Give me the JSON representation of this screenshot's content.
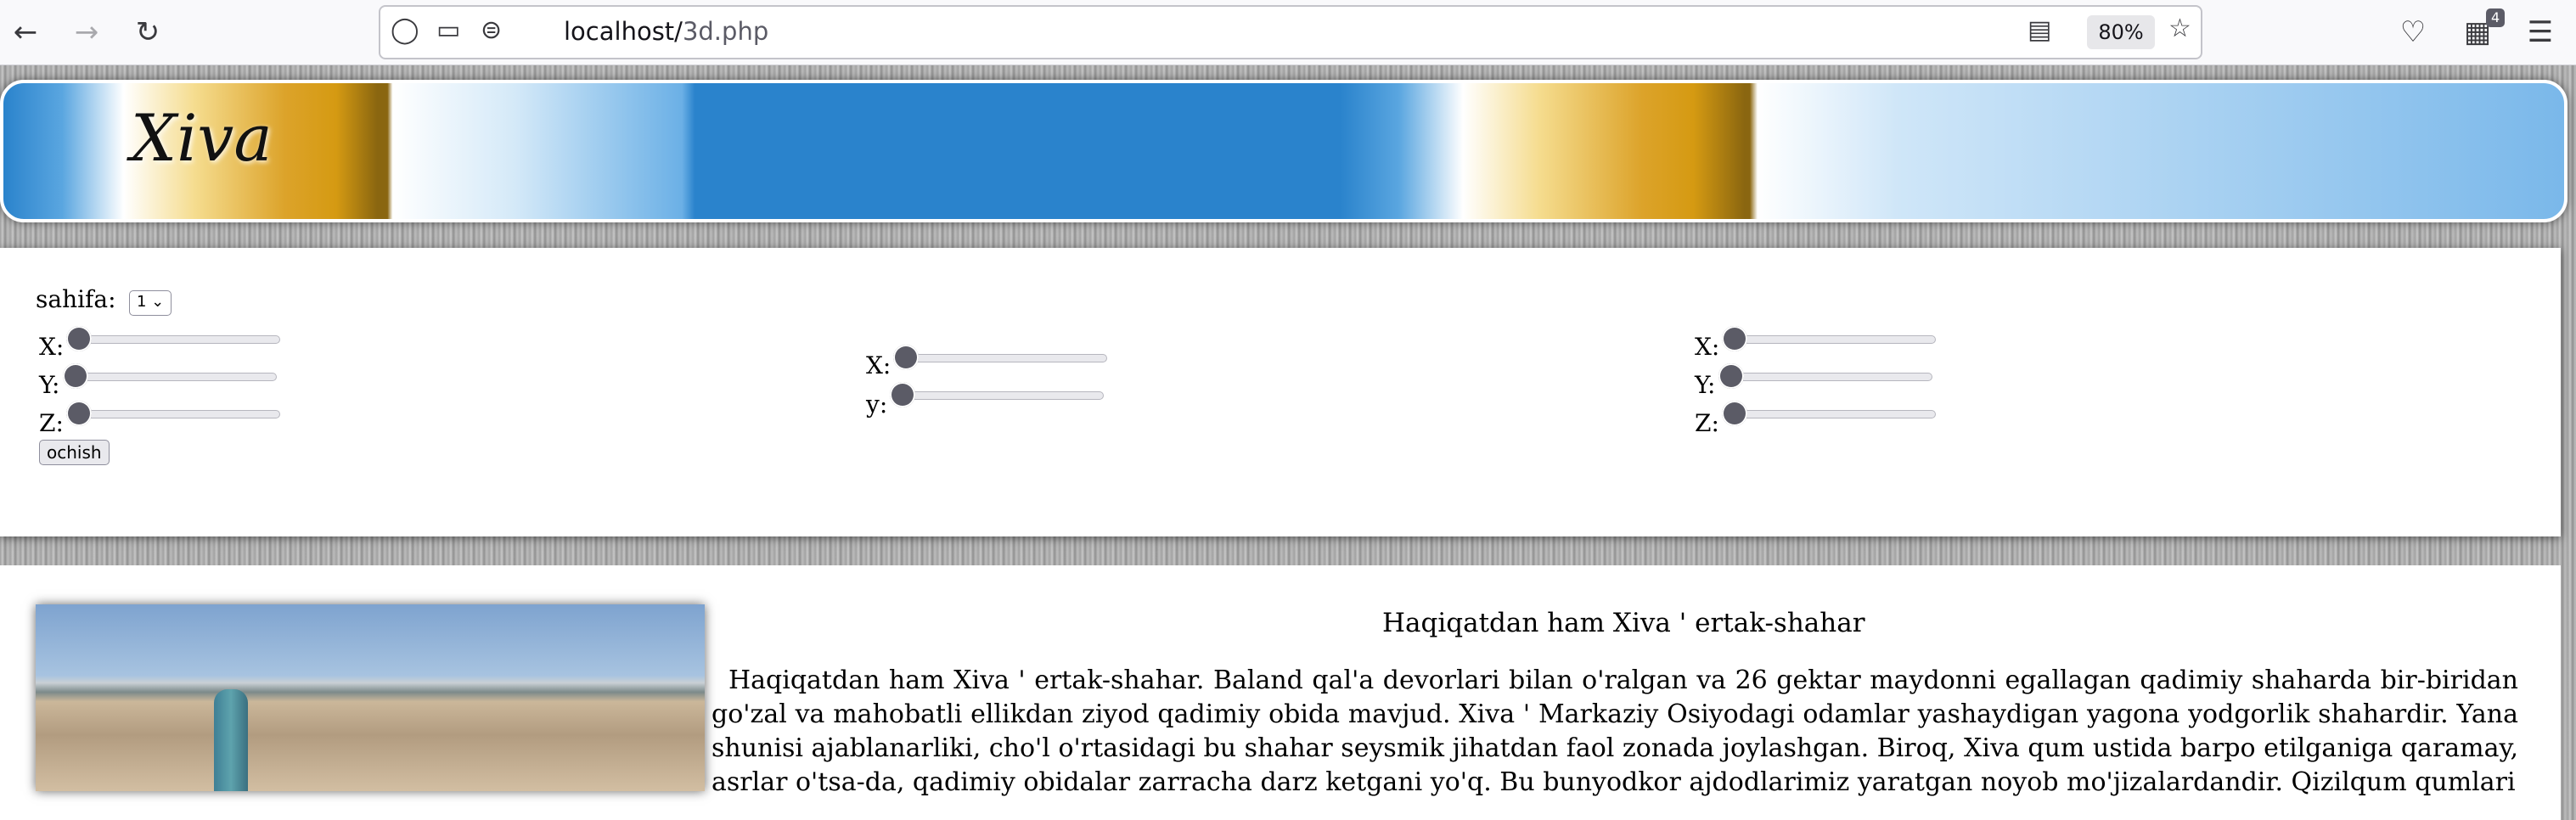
{
  "browser": {
    "url_host": "localhost/",
    "url_path": "3d.php",
    "zoom": "80%",
    "extensions_badge": "4"
  },
  "banner": {
    "title": "Xiva"
  },
  "controls": {
    "page_label": "sahifa:",
    "page_select_value": "1",
    "group1": {
      "x_label": "X:",
      "y_label": "Y:",
      "z_label": "Z:",
      "x_value": 0,
      "y_value": 0,
      "z_value": 0
    },
    "open_button": "ochish",
    "group2": {
      "x_label": "X:",
      "y_label": "y:",
      "x_value": 0,
      "y_value": 0
    },
    "group3": {
      "x_label": "X:",
      "y_label": "Y:",
      "z_label": "Z:",
      "x_value": 0,
      "y_value": 0,
      "z_value": 0
    }
  },
  "article": {
    "heading": "Haqiqatdan ham Xiva ' ertak-shahar",
    "body": "Haqiqatdan ham Xiva ' ertak-shahar. Baland qal'a devorlari bilan o'ralgan va 26 gektar maydonni egallagan qadimiy shaharda bir-biridan go'zal va mahobatli ellikdan ziyod qadimiy obida mavjud. Xiva ' Markaziy Osiyodagi odamlar yashaydigan yagona yodgorlik shahardir. Yana shunisi ajablanarliki, cho'l o'rtasidagi bu shahar seysmik jihatdan faol zonada joylashgan. Biroq, Xiva qum ustida barpo etilganiga qaramay, asrlar o'tsa-da, qadimiy obidalar zarracha darz ketgani yo'q. Bu bunyodkor ajdodlarimiz yaratgan noyob mo'jizalardandir. Qizilqum qumlari"
  }
}
